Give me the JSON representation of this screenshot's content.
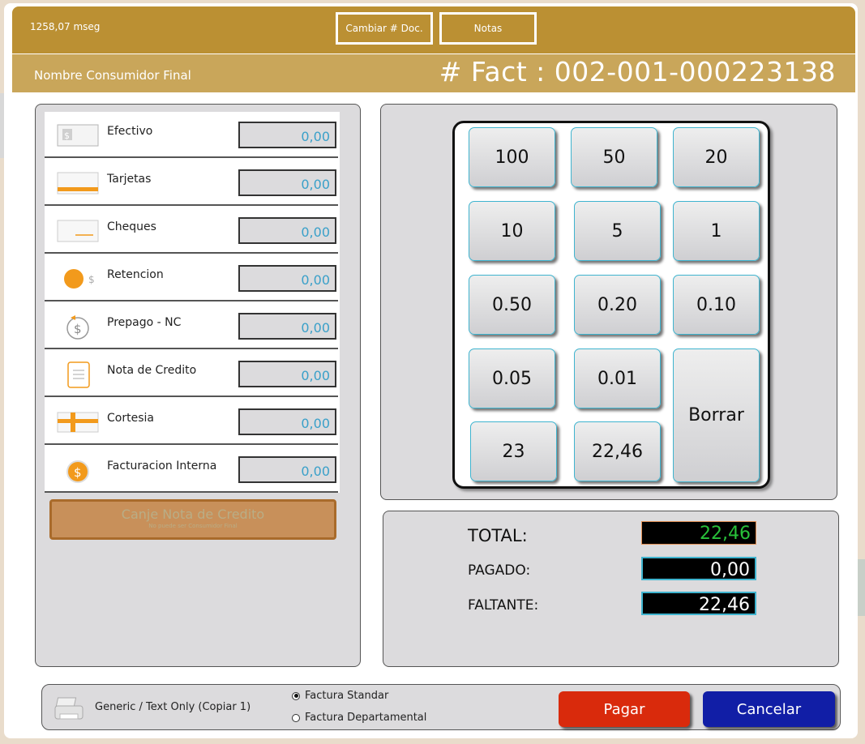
{
  "header": {
    "timing": "1258,07 mseg",
    "change_doc_label": "Cambiar # Doc.",
    "notes_label": "Notas",
    "customer": "Nombre Consumidor Final",
    "invoice_number": "# Fact : 002-001-000223138"
  },
  "payments": [
    {
      "icon": "cash-icon",
      "label": "Efectivo",
      "value": "0,00"
    },
    {
      "icon": "card-icon",
      "label": "Tarjetas",
      "value": "0,00"
    },
    {
      "icon": "check-icon",
      "label": "Cheques",
      "value": "0,00"
    },
    {
      "icon": "coin-icon",
      "label": "Retencion",
      "value": "0,00"
    },
    {
      "icon": "prepaid-icon",
      "label": "Prepago - NC",
      "value": "0,00"
    },
    {
      "icon": "document-icon",
      "label": "Nota de Credito",
      "value": "0,00"
    },
    {
      "icon": "gift-icon",
      "label": "Cortesia",
      "value": "0,00"
    },
    {
      "icon": "dollar-coin-icon",
      "label": "Facturacion Interna",
      "value": "0,00"
    }
  ],
  "canje": {
    "title": "Canje Nota de Credito",
    "subtitle": "No puede ser Consumidor Final"
  },
  "keypad": {
    "k100": "100",
    "k50": "50",
    "k20": "20",
    "k10": "10",
    "k5": "5",
    "k1": "1",
    "k050": "0.50",
    "k020": "0.20",
    "k010": "0.10",
    "k005": "0.05",
    "k001": "0.01",
    "clear": "Borrar",
    "k23": "23",
    "k2246": "22,46"
  },
  "totals": {
    "total_label": "TOTAL:",
    "total_value": "22,46",
    "paid_label": "PAGADO:",
    "paid_value": "0,00",
    "missing_label": "FALTANTE:",
    "missing_value": "22,46"
  },
  "footer": {
    "printer": "Generic / Text Only (Copiar 1)",
    "radio_standard": "Factura Standar",
    "radio_departmental": "Factura Departamental",
    "pay_label": "Pagar",
    "cancel_label": "Cancelar"
  },
  "colors": {
    "header_gold": "#bb9033",
    "subheader_gold": "#c9a65a",
    "value_blue": "#3aa0c9",
    "total_green": "#28c13a",
    "pay_red": "#d92a0c",
    "cancel_blue": "#111ea6"
  }
}
